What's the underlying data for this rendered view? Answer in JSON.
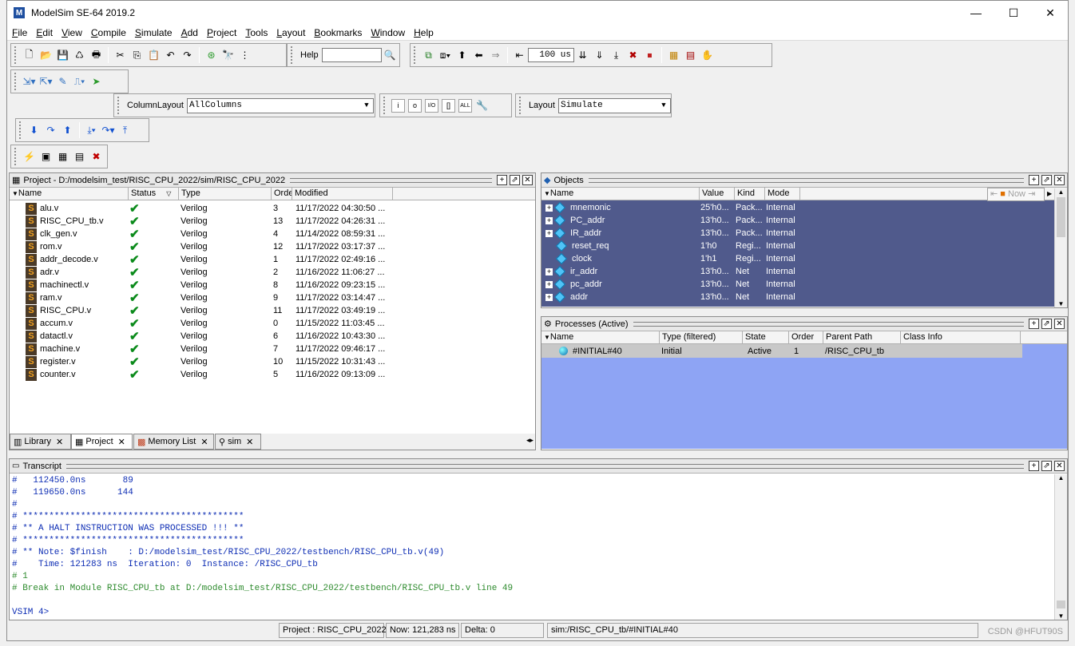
{
  "window": {
    "title": "ModelSim SE-64 2019.2",
    "logo_letter": "M",
    "minimize": "—",
    "maximize": "☐",
    "close": "✕"
  },
  "menu": [
    "File",
    "Edit",
    "View",
    "Compile",
    "Simulate",
    "Add",
    "Project",
    "Tools",
    "Layout",
    "Bookmarks",
    "Window",
    "Help"
  ],
  "toolbar": {
    "help_label": "Help",
    "help_value": "",
    "run_length": "100 us",
    "column_layout_label": "ColumnLayout",
    "column_layout_value": "AllColumns",
    "layout_label": "Layout",
    "layout_value": "Simulate"
  },
  "project_pane": {
    "title": "Project - D:/modelsim_test/RISC_CPU_2022/sim/RISC_CPU_2022",
    "columns": [
      "Name",
      "Status",
      "Type",
      "Order",
      "Modified"
    ],
    "rows": [
      {
        "name": "alu.v",
        "type": "Verilog",
        "order": "3",
        "modified": "11/17/2022 04:30:50 ..."
      },
      {
        "name": "RISC_CPU_tb.v",
        "type": "Verilog",
        "order": "13",
        "modified": "11/17/2022 04:26:31 ..."
      },
      {
        "name": "clk_gen.v",
        "type": "Verilog",
        "order": "4",
        "modified": "11/14/2022 08:59:31 ..."
      },
      {
        "name": "rom.v",
        "type": "Verilog",
        "order": "12",
        "modified": "11/17/2022 03:17:37 ..."
      },
      {
        "name": "addr_decode.v",
        "type": "Verilog",
        "order": "1",
        "modified": "11/17/2022 02:49:16 ..."
      },
      {
        "name": "adr.v",
        "type": "Verilog",
        "order": "2",
        "modified": "11/16/2022 11:06:27 ..."
      },
      {
        "name": "machinectl.v",
        "type": "Verilog",
        "order": "8",
        "modified": "11/16/2022 09:23:15 ..."
      },
      {
        "name": "ram.v",
        "type": "Verilog",
        "order": "9",
        "modified": "11/17/2022 03:14:47 ..."
      },
      {
        "name": "RISC_CPU.v",
        "type": "Verilog",
        "order": "11",
        "modified": "11/17/2022 03:49:19 ..."
      },
      {
        "name": "accum.v",
        "type": "Verilog",
        "order": "0",
        "modified": "11/15/2022 11:03:45 ..."
      },
      {
        "name": "datactl.v",
        "type": "Verilog",
        "order": "6",
        "modified": "11/16/2022 10:43:30 ..."
      },
      {
        "name": "machine.v",
        "type": "Verilog",
        "order": "7",
        "modified": "11/17/2022 09:46:17 ..."
      },
      {
        "name": "register.v",
        "type": "Verilog",
        "order": "10",
        "modified": "11/15/2022 10:31:43 ..."
      },
      {
        "name": "counter.v",
        "type": "Verilog",
        "order": "5",
        "modified": "11/16/2022 09:13:09 ..."
      }
    ],
    "tabs": [
      "Library",
      "Project",
      "Memory List",
      "sim"
    ]
  },
  "objects_pane": {
    "title": "Objects",
    "columns": [
      "Name",
      "Value",
      "Kind",
      "Mode"
    ],
    "now_label": "Now",
    "rows": [
      {
        "name": "mnemonic",
        "value": "25'h0...",
        "kind": "Pack...",
        "mode": "Internal",
        "expandable": true
      },
      {
        "name": "PC_addr",
        "value": "13'h0...",
        "kind": "Pack...",
        "mode": "Internal",
        "expandable": true
      },
      {
        "name": "IR_addr",
        "value": "13'h0...",
        "kind": "Pack...",
        "mode": "Internal",
        "expandable": true
      },
      {
        "name": "reset_req",
        "value": "1'h0",
        "kind": "Regi...",
        "mode": "Internal",
        "expandable": false
      },
      {
        "name": "clock",
        "value": "1'h1",
        "kind": "Regi...",
        "mode": "Internal",
        "expandable": false
      },
      {
        "name": "ir_addr",
        "value": "13'h0...",
        "kind": "Net",
        "mode": "Internal",
        "expandable": true
      },
      {
        "name": "pc_addr",
        "value": "13'h0...",
        "kind": "Net",
        "mode": "Internal",
        "expandable": true
      },
      {
        "name": "addr",
        "value": "13'h0...",
        "kind": "Net",
        "mode": "Internal",
        "expandable": true
      }
    ]
  },
  "processes_pane": {
    "title": "Processes (Active)",
    "columns": [
      "Name",
      "Type (filtered)",
      "State",
      "Order",
      "Parent Path",
      "Class Info"
    ],
    "rows": [
      {
        "name": "#INITIAL#40",
        "type": "Initial",
        "state": "Active",
        "order": "1",
        "parent": "/RISC_CPU_tb",
        "class": ""
      }
    ]
  },
  "transcript": {
    "title": "Transcript",
    "lines": [
      {
        "text": "#   112450.0ns       89",
        "green": false
      },
      {
        "text": "#   119650.0ns      144",
        "green": false
      },
      {
        "text": "#",
        "green": false
      },
      {
        "text": "# ******************************************",
        "green": false
      },
      {
        "text": "# ** A HALT INSTRUCTION WAS PROCESSED !!! **",
        "green": false
      },
      {
        "text": "# ******************************************",
        "green": false
      },
      {
        "text": "# ** Note: $finish    : D:/modelsim_test/RISC_CPU_2022/testbench/RISC_CPU_tb.v(49)",
        "green": false
      },
      {
        "text": "#    Time: 121283 ns  Iteration: 0  Instance: /RISC_CPU_tb",
        "green": false
      },
      {
        "text": "# 1",
        "green": true
      },
      {
        "text": "# Break in Module RISC_CPU_tb at D:/modelsim_test/RISC_CPU_2022/testbench/RISC_CPU_tb.v line 49",
        "green": true
      },
      {
        "text": "",
        "green": false
      },
      {
        "text": "VSIM 4>",
        "green": false
      }
    ]
  },
  "status": {
    "project": "Project : RISC_CPU_2022",
    "now": "Now: 121,283 ns",
    "delta": "Delta: 0",
    "context": "sim:/RISC_CPU_tb/#INITIAL#40"
  },
  "watermark": "CSDN @HFUT90S"
}
